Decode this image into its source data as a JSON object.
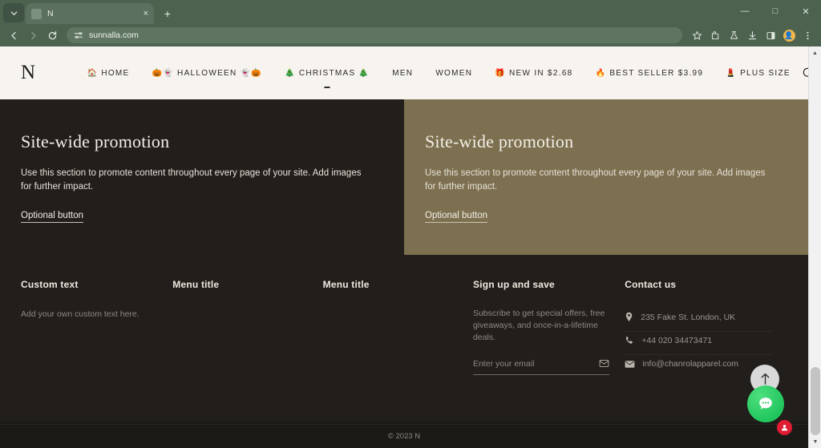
{
  "browser": {
    "tab": {
      "title": "N",
      "favicon": "page-icon",
      "close_label": "×"
    },
    "newtab_label": "+",
    "window": {
      "minimize": "—",
      "maximize": "□",
      "close": "✕"
    },
    "nav": {
      "back": "←",
      "forward": "→",
      "reload": "↻"
    },
    "omnibox": {
      "url": "sunnalla.com",
      "site_icon": "tune-icon"
    },
    "toolbar_icons": [
      "bookmark-star-icon",
      "extensions-icon",
      "lab-flask-icon",
      "downloads-icon",
      "side-panel-icon",
      "profile-avatar-icon",
      "chrome-menu-icon"
    ]
  },
  "site": {
    "logo": "N",
    "nav_items": [
      {
        "label": "HOME",
        "emoji_left": "🏠",
        "emoji_right": "",
        "caret": false
      },
      {
        "label": "HALLOWEEN",
        "emoji_left": "🎃👻",
        "emoji_right": "👻🎃",
        "caret": false
      },
      {
        "label": "CHRISTMAS",
        "emoji_left": "🎄",
        "emoji_right": "🎄",
        "caret": true
      },
      {
        "label": "MEN",
        "emoji_left": "",
        "emoji_right": "",
        "caret": false
      },
      {
        "label": "WOMEN",
        "emoji_left": "",
        "emoji_right": "",
        "caret": false
      },
      {
        "label": "NEW IN $2.68",
        "emoji_left": "🎁",
        "emoji_right": "",
        "caret": false
      },
      {
        "label": "BEST SELLER $3.99",
        "emoji_left": "🔥",
        "emoji_right": "",
        "caret": false
      },
      {
        "label": "PLUS SIZE",
        "emoji_left": "💄",
        "emoji_right": "",
        "caret": false
      }
    ],
    "search_icon": "search-icon"
  },
  "promotions": [
    {
      "heading": "Site-wide promotion",
      "body": "Use this section to promote content throughout every page of your site. Add images for further impact.",
      "button": "Optional button",
      "bg": "#211e1b"
    },
    {
      "heading": "Site-wide promotion",
      "body": "Use this section to promote content throughout every page of your site. Add images for further impact.",
      "button": "Optional button",
      "bg": "#7d7050"
    }
  ],
  "footer": {
    "custom": {
      "title": "Custom text",
      "body": "Add your own custom text here."
    },
    "menu1": {
      "title": "Menu title"
    },
    "menu2": {
      "title": "Menu title"
    },
    "signup": {
      "title": "Sign up and save",
      "body": "Subscribe to get special offers, free giveaways, and once-in-a-lifetime deals.",
      "placeholder": "Enter your email",
      "value": "",
      "submit_icon": "envelope-icon"
    },
    "contact": {
      "title": "Contact us",
      "rows": [
        {
          "icon": "location-pin-icon",
          "text": "235 Fake St. London, UK"
        },
        {
          "icon": "phone-icon",
          "text": "+44 020 34473471"
        },
        {
          "icon": "envelope-icon",
          "text": "info@chanrolapparel.com"
        }
      ]
    },
    "copyright": "© 2023 N"
  },
  "widgets": {
    "scroll_top": {
      "icon": "arrow-up-icon"
    },
    "chat": {
      "icon": "chat-bubble-icon"
    },
    "badge": {
      "icon": "notification-dot-icon",
      "label": "●"
    }
  },
  "colors": {
    "chrome": "#4d6350",
    "header_bg": "#f7f3ee",
    "promo_dark": "#211e1b",
    "promo_tan": "#7d7050",
    "chat_green": "#21c55d",
    "badge_red": "#e01b32"
  }
}
